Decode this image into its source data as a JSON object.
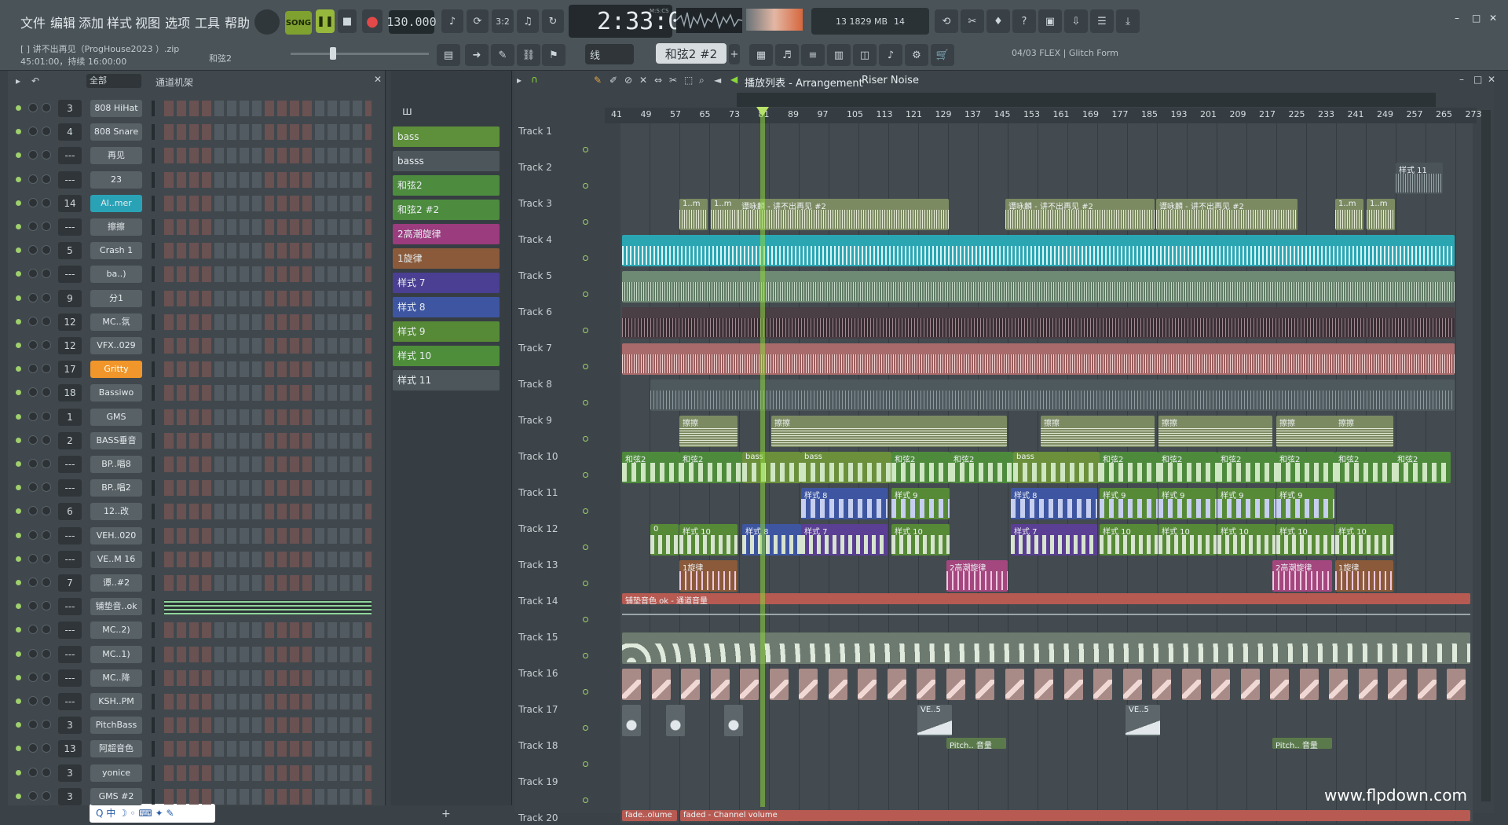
{
  "menu": [
    "文件",
    "编辑",
    "添加",
    "样式",
    "视图",
    "选项",
    "工具",
    "帮助"
  ],
  "transport": {
    "song_label": "SONG",
    "bpm": "130.000",
    "clock": "2:33:02",
    "clock_unit": "M:S:CS",
    "mem": "13  1829 MB",
    "poly": "14",
    "pattern": "和弦2 #2",
    "flex": "04/03  FLEX | Glitch Form",
    "snap": "线"
  },
  "song": {
    "name": "[  ] 讲不出再见（ProgHouse2023 ）.zip",
    "time": "45:01:00，持续 16:00:00",
    "channel": "和弦2"
  },
  "rack": {
    "header": "通道机架",
    "filter": "全部"
  },
  "channels": [
    {
      "num": "3",
      "name": "808 HiHat"
    },
    {
      "num": "4",
      "name": "808 Snare"
    },
    {
      "num": "---",
      "name": "再见"
    },
    {
      "num": "---",
      "name": "23"
    },
    {
      "num": "14",
      "name": "Al..mer"
    },
    {
      "num": "---",
      "name": "擦擦"
    },
    {
      "num": "5",
      "name": "Crash 1"
    },
    {
      "num": "---",
      "name": "ba..)"
    },
    {
      "num": "9",
      "name": "分1"
    },
    {
      "num": "12",
      "name": "MC..氛"
    },
    {
      "num": "12",
      "name": "VFX..029"
    },
    {
      "num": "17",
      "name": "Gritty"
    },
    {
      "num": "18",
      "name": "Bassiwo"
    },
    {
      "num": "1",
      "name": "GMS"
    },
    {
      "num": "2",
      "name": "BASS垂音"
    },
    {
      "num": "---",
      "name": "BP..唱8"
    },
    {
      "num": "---",
      "name": "BP..唱2"
    },
    {
      "num": "6",
      "name": "12..改"
    },
    {
      "num": "---",
      "name": "VEH..020"
    },
    {
      "num": "---",
      "name": "VE..M 16"
    },
    {
      "num": "7",
      "name": "谭..#2"
    },
    {
      "num": "---",
      "name": "铺垫音..ok"
    },
    {
      "num": "---",
      "name": "MC..2)"
    },
    {
      "num": "---",
      "name": "MC..1)"
    },
    {
      "num": "---",
      "name": "MC..降"
    },
    {
      "num": "---",
      "name": "KSH..PM"
    },
    {
      "num": "3",
      "name": "PitchBass"
    },
    {
      "num": "13",
      "name": "阿超音色"
    },
    {
      "num": "3",
      "name": "yonice"
    },
    {
      "num": "3",
      "name": "GMS #2"
    }
  ],
  "patterns": [
    {
      "name": "bass",
      "color": "#5e8f3a"
    },
    {
      "name": "basss",
      "color": "#4d565b"
    },
    {
      "name": "和弦2",
      "color": "#4d8b3f"
    },
    {
      "name": "和弦2 #2",
      "color": "#4d8b3f"
    },
    {
      "name": "2高潮旋律",
      "color": "#9a3c7e"
    },
    {
      "name": "1旋律",
      "color": "#8a5a3a"
    },
    {
      "name": "样式 7",
      "color": "#4a3f93"
    },
    {
      "name": "样式 8",
      "color": "#3e56a1"
    },
    {
      "name": "样式 9",
      "color": "#578a37"
    },
    {
      "name": "样式 10",
      "color": "#4e8e3a"
    },
    {
      "name": "样式 11",
      "color": "#4d565b"
    }
  ],
  "playlist": {
    "title": "播放列表 - Arrangement",
    "sub": "Riser Noise"
  },
  "ruler": [
    "41",
    "49",
    "57",
    "65",
    "73",
    "81",
    "89",
    "97",
    "105",
    "113",
    "121",
    "129",
    "137",
    "145",
    "153",
    "161",
    "169",
    "177",
    "185",
    "193",
    "201",
    "209",
    "217",
    "225",
    "233",
    "241",
    "249",
    "257",
    "265",
    "273"
  ],
  "tracks": [
    "Track 1",
    "Track 2",
    "Track 3",
    "Track 4",
    "Track 5",
    "Track 6",
    "Track 7",
    "Track 8",
    "Track 9",
    "Track 10",
    "Track 11",
    "Track 12",
    "Track 13",
    "Track 14",
    "Track 15",
    "Track 16",
    "Track 17",
    "Track 18",
    "Track 19",
    "Track 20"
  ],
  "clip_labels": {
    "t3": [
      "1..m",
      "1..m",
      "谭咏麟 - 讲不出再见 #2",
      "谭咏麟 - 讲不出再见 #2",
      "谭咏麟 - 讲不出再见 #2",
      "1..m",
      "1..m"
    ],
    "t2": "样式 11",
    "t9": "擦擦",
    "t10": [
      "和弦2",
      "和弦2",
      "bass",
      "bass",
      "和弦2",
      "和弦2",
      "bass",
      "和弦2",
      "和弦2",
      "和弦2",
      "和弦2",
      "和弦2",
      "和弦2"
    ],
    "t11": [
      "样式 8",
      "样式 9",
      "样式 8",
      "样式 9",
      "样式 9",
      "样式 9",
      "样式 9"
    ],
    "t12": [
      "0",
      "样式 10",
      "样式 8",
      "样式 7",
      "样式 10",
      "样式 7",
      "样式 10",
      "样式 10",
      "样式 10",
      "样式 10",
      "样式 10"
    ],
    "t13": [
      "1旋律",
      "2高潮旋律",
      "2高潮旋律",
      "1旋律"
    ],
    "t14": "铺垫音色 ok - 通道音量",
    "t17": [
      "VE..5",
      "VE..5"
    ],
    "t18": [
      "Pitch.. 音量",
      "Pitch.. 音量"
    ],
    "t20": [
      "fade..olume",
      "faded - Channel volume"
    ]
  },
  "watermark": "www.flpdown.com",
  "colors": {
    "green": "#8cd63c",
    "track_red": "#b75a52",
    "clip_green": "#5f8f3f",
    "clip_blue": "#3e56a1",
    "clip_purple": "#5b3f94",
    "clip_pink": "#a4477f",
    "teal": "#2ab5c0"
  }
}
